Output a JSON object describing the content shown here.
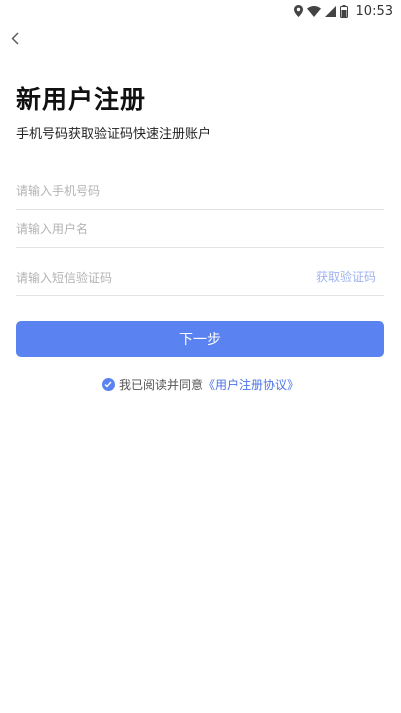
{
  "status_bar": {
    "time": "10:53",
    "icons": [
      "location-icon",
      "wifi-icon",
      "signal-icon",
      "battery-icon"
    ]
  },
  "header": {
    "back_icon": "chevron-left-icon",
    "title": "新用户注册",
    "subtitle": "手机号码获取验证码快速注册账户"
  },
  "form": {
    "phone": {
      "value": "",
      "placeholder": "请输入手机号码"
    },
    "username": {
      "value": "",
      "placeholder": "请输入用户名"
    },
    "sms_code": {
      "value": "",
      "placeholder": "请输入短信验证码"
    },
    "get_code_label": "获取验证码",
    "next_label": "下一步"
  },
  "agreement": {
    "checked": true,
    "text": "我已阅读并同意",
    "link": "《用户注册协议》"
  },
  "colors": {
    "primary": "#5b82f1",
    "link": "#4b73e8",
    "get_code": "#9fb2ef",
    "divider": "#e3e3e3",
    "placeholder": "#b3b3b3"
  }
}
